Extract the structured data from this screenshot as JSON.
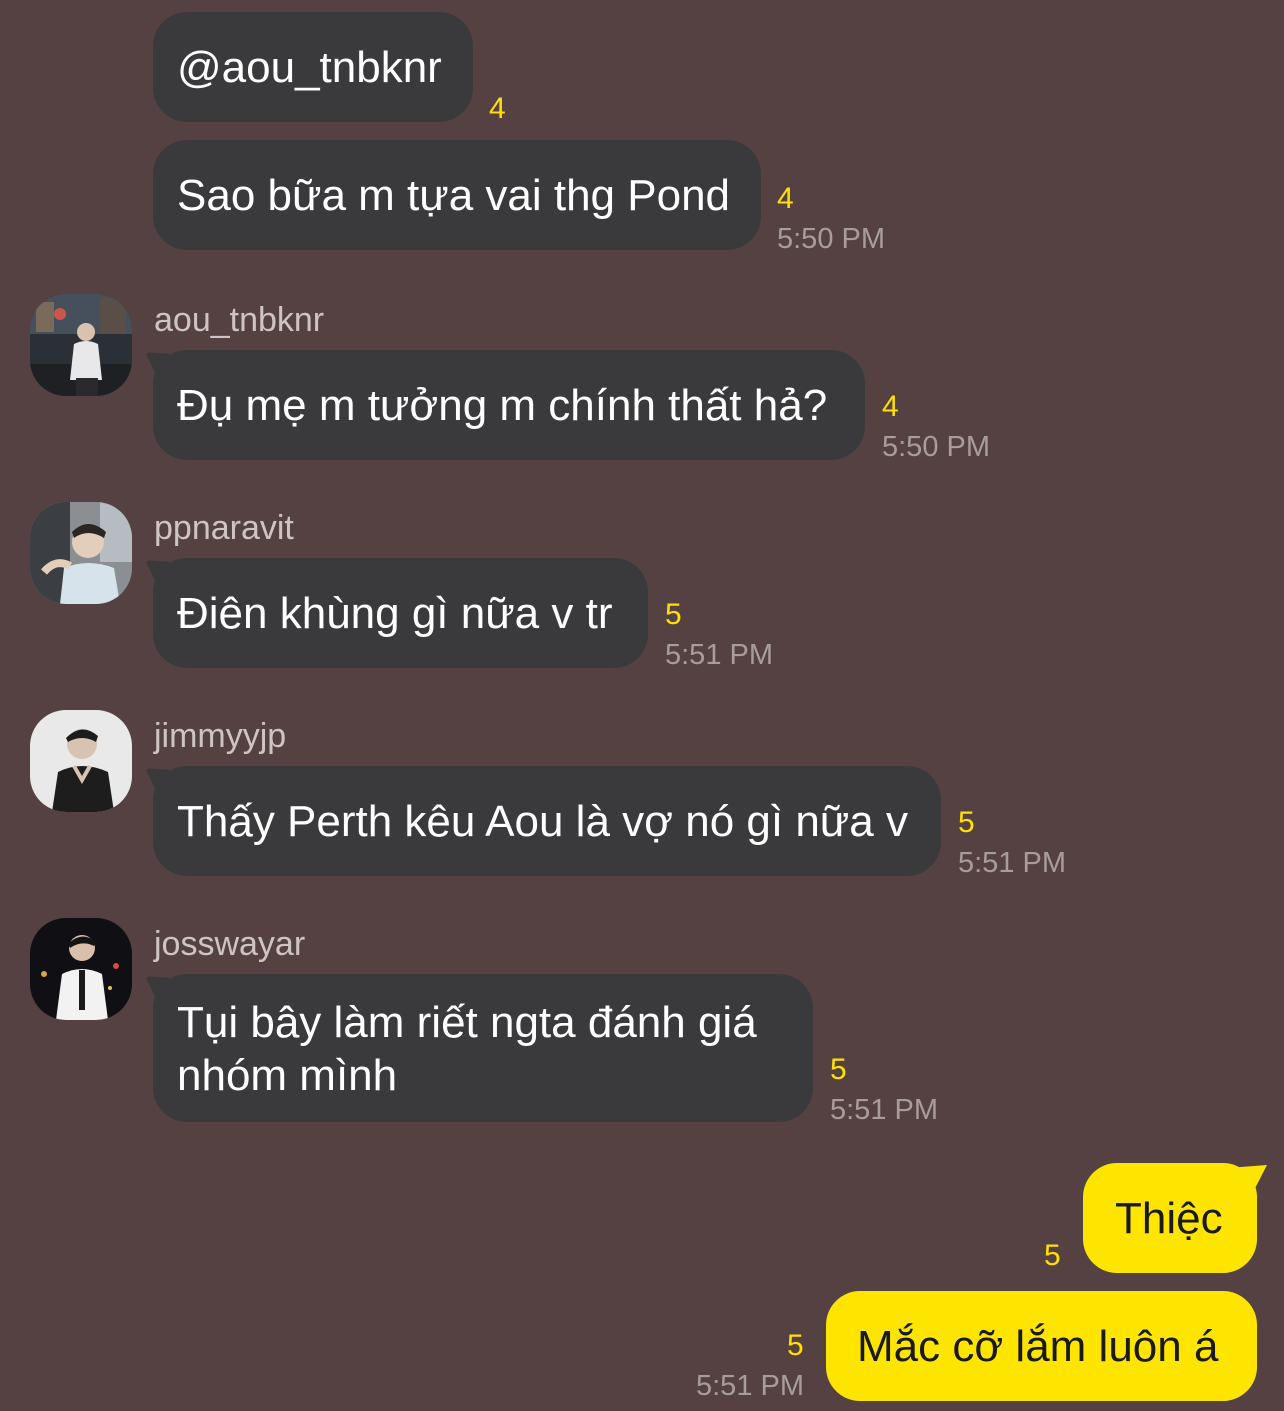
{
  "messages": [
    {
      "text": "@aou_tnbknr",
      "unread": "4"
    },
    {
      "text": "Sao bữa m tựa vai thg Pond",
      "unread": "4",
      "time": "5:50 PM"
    },
    {
      "sender": "aou_tnbknr",
      "text": "Đụ mẹ m tưởng m chính thất hả?",
      "unread": "4",
      "time": "5:50 PM"
    },
    {
      "sender": "ppnaravit",
      "text": "Điên khùng gì nữa v tr",
      "unread": "5",
      "time": "5:51 PM"
    },
    {
      "sender": "jimmyyjp",
      "text": "Thấy Perth kêu Aou là vợ nó gì nữa v",
      "unread": "5",
      "time": "5:51 PM"
    },
    {
      "sender": "josswayar",
      "text_line1": "Tụi bây làm riết ngta đánh giá",
      "text_line2": "nhóm mình",
      "unread": "5",
      "time": "5:51 PM"
    }
  ],
  "my_messages": [
    {
      "text": "Thiệc",
      "unread": "5"
    },
    {
      "text": "Mắc cỡ lắm luôn á",
      "unread": "5",
      "time": "5:51 PM"
    }
  ],
  "colors": {
    "background": "#554141",
    "incoming_bubble": "#3a3a3c",
    "outgoing_bubble": "#fee500",
    "unread_count": "#ffe000",
    "timestamp": "#a89c9c"
  }
}
